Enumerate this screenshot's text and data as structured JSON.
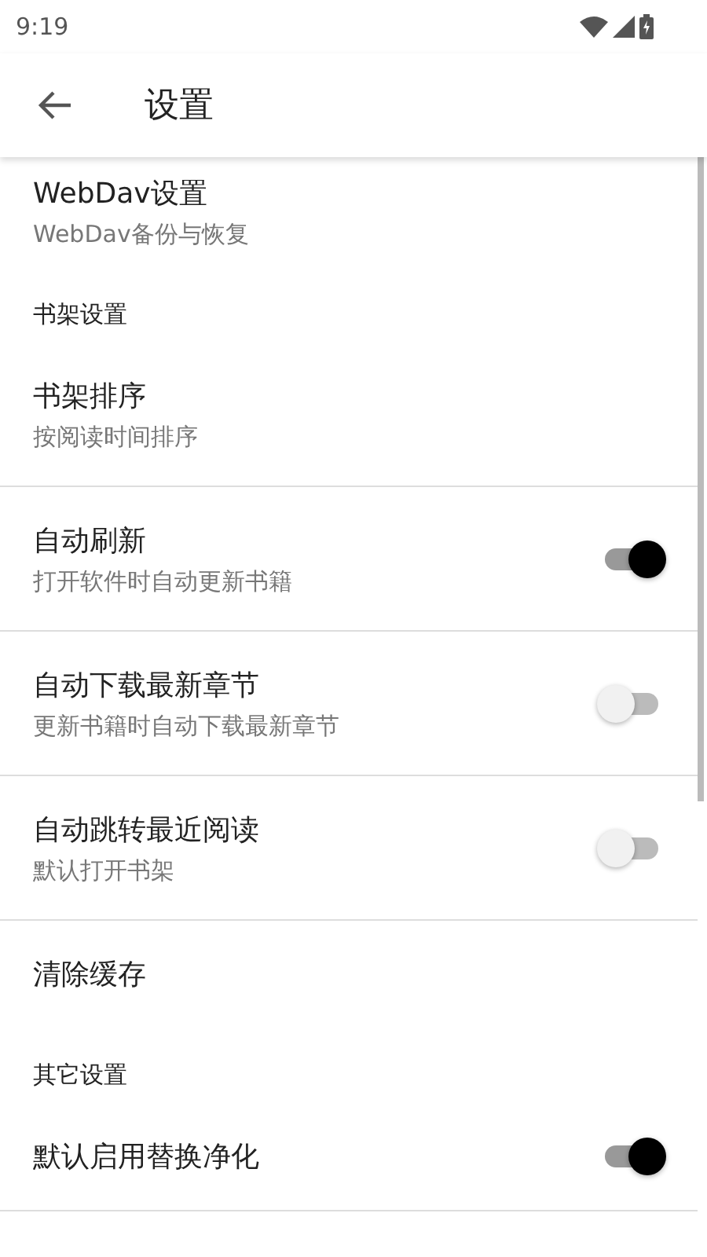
{
  "status_bar": {
    "time": "9:19"
  },
  "app_bar": {
    "title": "设置"
  },
  "sections": [
    {
      "items": [
        {
          "kind": "item",
          "title": "WebDav设置",
          "summary": "WebDav备份与恢复"
        },
        {
          "kind": "category",
          "title": "书架设置"
        },
        {
          "kind": "item",
          "title": "书架排序",
          "summary": "按阅读时间排序"
        }
      ]
    },
    {
      "items": [
        {
          "kind": "switch",
          "title": "自动刷新",
          "summary": "打开软件时自动更新书籍",
          "on": true
        }
      ]
    },
    {
      "items": [
        {
          "kind": "switch",
          "title": "自动下载最新章节",
          "summary": "更新书籍时自动下载最新章节",
          "on": false
        }
      ]
    },
    {
      "items": [
        {
          "kind": "switch",
          "title": "自动跳转最近阅读",
          "summary": "默认打开书架",
          "on": false
        }
      ]
    },
    {
      "items": [
        {
          "kind": "item",
          "title": "清除缓存"
        },
        {
          "kind": "category",
          "title": "其它设置"
        },
        {
          "kind": "switch",
          "title": "默认启用替换净化",
          "on": true
        }
      ]
    }
  ]
}
